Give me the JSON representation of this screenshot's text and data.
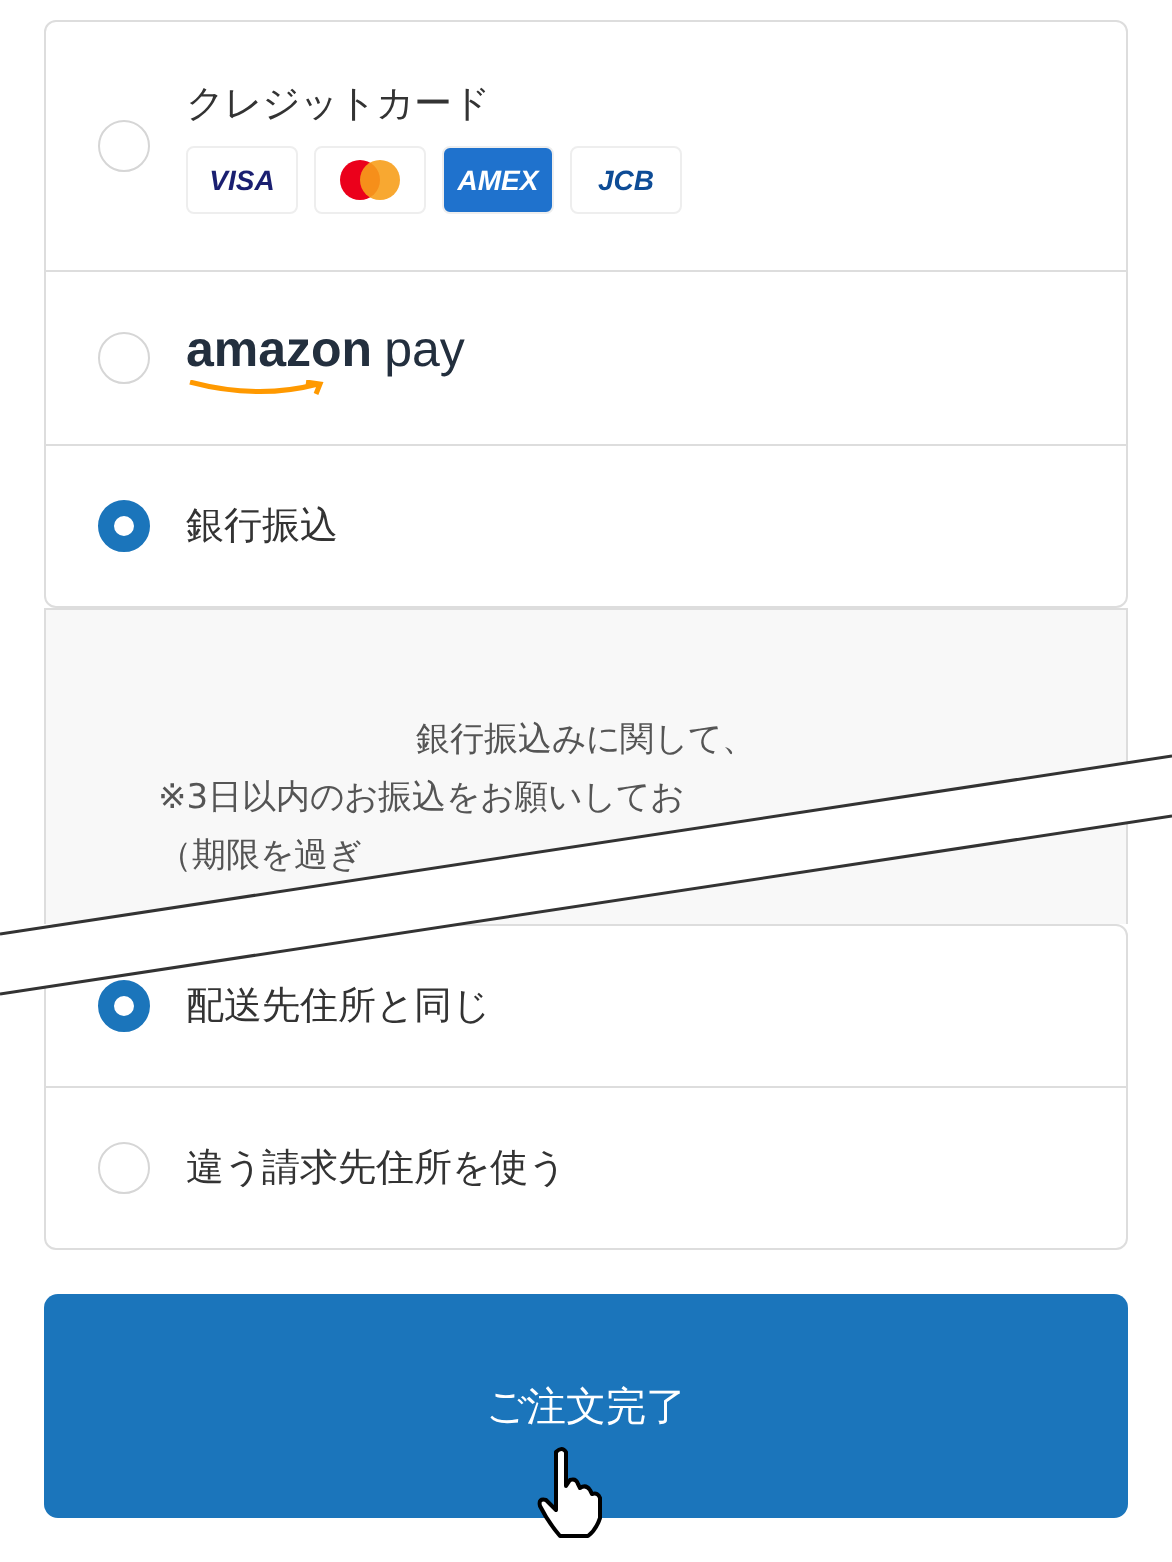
{
  "payment_methods": [
    {
      "kind": "card",
      "label": "クレジットカード",
      "selected": false,
      "brands": [
        {
          "kind": "visa",
          "label": "VISA"
        },
        {
          "kind": "mastercard"
        },
        {
          "kind": "amex",
          "label": "AMEX"
        },
        {
          "kind": "jcb",
          "label": "JCB"
        }
      ]
    },
    {
      "kind": "amazon",
      "label": "amazon",
      "suffix": "pay",
      "selected": false
    },
    {
      "kind": "bank",
      "label": "銀行振込",
      "selected": true
    }
  ],
  "bank_note": [
    "銀行振込みに関して、",
    "※3日以内のお振込をお願いしてお",
    "（期限を過ぎ"
  ],
  "billing_options": [
    {
      "label": "配送先住所と同じ",
      "selected": true
    },
    {
      "label": "違う請求先住所を使う",
      "selected": false
    }
  ],
  "submit_button": "ご注文完了"
}
